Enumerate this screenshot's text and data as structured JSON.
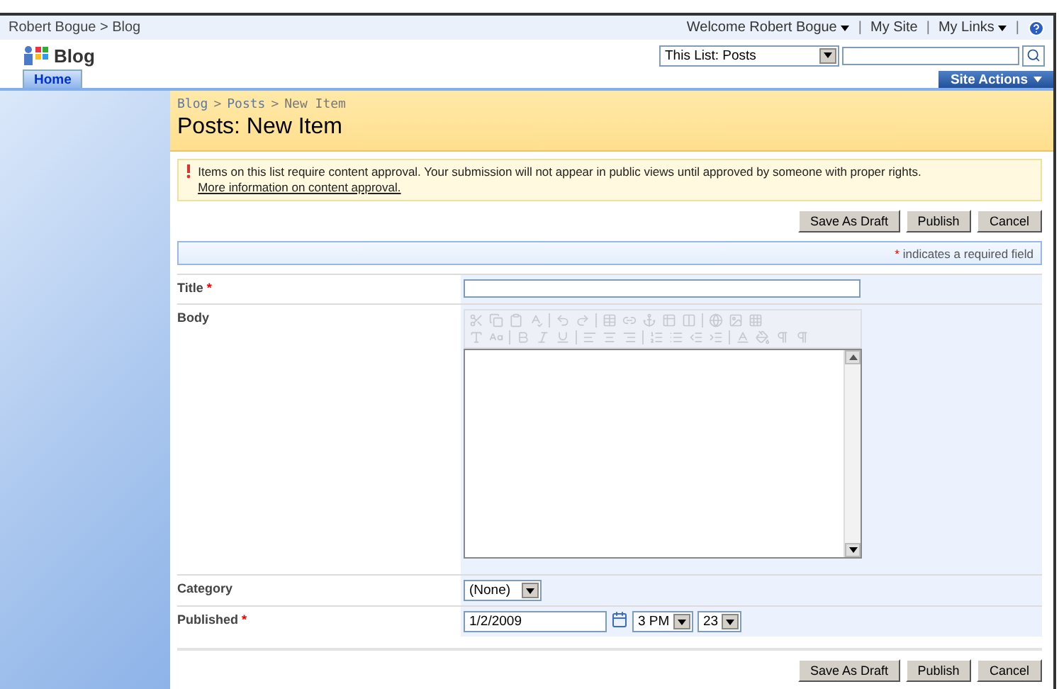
{
  "top_bar": {
    "breadcrumb": "Robert Bogue > Blog",
    "welcome": "Welcome Robert Bogue",
    "links": [
      "My Site",
      "My Links"
    ],
    "separator": "|"
  },
  "header": {
    "site_title": "Blog",
    "scope": "This List: Posts"
  },
  "tabs": [
    {
      "label": "Home",
      "selected": true
    }
  ],
  "site_actions": "Site Actions",
  "page": {
    "breadcrumb": [
      "Blog",
      "Posts",
      "New Item"
    ],
    "breadcrumb_separator": ">",
    "title": "Posts: New Item"
  },
  "notice": {
    "text": "Items on this list require content approval. Your submission will not appear in public views until approved by someone with proper rights.",
    "link": "More information on content approval."
  },
  "buttons_top": [
    "Save As Draft",
    "Publish",
    "Cancel"
  ],
  "required_note": {
    "mark": "*",
    "text": "indicates a required field"
  },
  "fields": [
    {
      "label": "Title",
      "required_mark": "*",
      "kind": "text"
    },
    {
      "label": "Body",
      "kind": "rich",
      "toolbar_disabled": true
    },
    {
      "label": "Category",
      "kind": "select",
      "value": "(None)"
    },
    {
      "label": "Published",
      "required_mark": "*",
      "kind": "datetime",
      "date": "1/2/2009",
      "hour": "3 PM",
      "minute": "23"
    }
  ],
  "buttons_bottom": [
    "Save As Draft",
    "Publish",
    "Cancel"
  ]
}
